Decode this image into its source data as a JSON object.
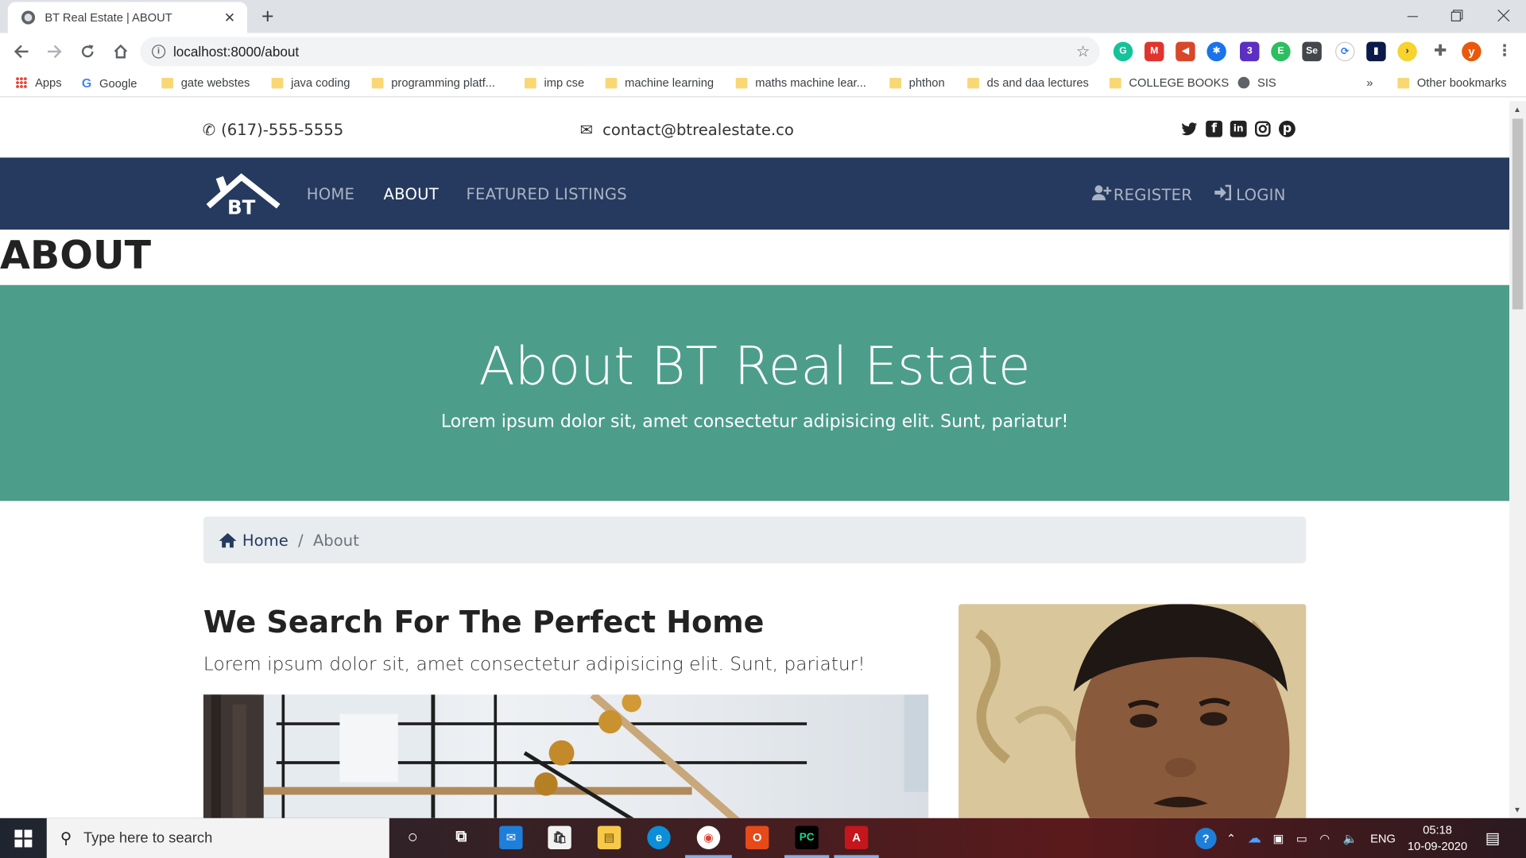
{
  "browser": {
    "tab_title": "BT Real Estate | ABOUT",
    "tab_close": "✕",
    "new_tab": "+",
    "url": "localhost:8000/about",
    "bookmarks": [
      {
        "label": "Apps",
        "icon": "apps-grid-icon"
      },
      {
        "label": "Google",
        "icon": "google-icon"
      },
      {
        "label": "gate webstes",
        "icon": "folder-icon"
      },
      {
        "label": "java coding",
        "icon": "folder-icon"
      },
      {
        "label": "programming platf...",
        "icon": "folder-icon"
      },
      {
        "label": "imp cse",
        "icon": "folder-icon"
      },
      {
        "label": "machine learning",
        "icon": "folder-icon"
      },
      {
        "label": "maths machine lear...",
        "icon": "folder-icon"
      },
      {
        "label": "phthon",
        "icon": "folder-icon"
      },
      {
        "label": "ds and daa lectures",
        "icon": "folder-icon"
      },
      {
        "label": "COLLEGE BOOKS",
        "icon": "folder-icon"
      },
      {
        "label": "SIS",
        "icon": "globe-icon"
      }
    ],
    "bookmarks_overflow": "»",
    "other_bookmarks": "Other bookmarks",
    "profile_initial": "y"
  },
  "site": {
    "phone": "(617)-555-5555",
    "email": "contact@btrealestate.co",
    "logo_text": "BT",
    "nav": {
      "home": "HOME",
      "about": "ABOUT",
      "featured": "FEATURED LISTINGS",
      "register": "REGISTER",
      "login": "LOGIN"
    },
    "page_heading": "ABOUT",
    "hero_title": "About BT Real Estate",
    "hero_subtitle": "Lorem ipsum dolor sit, amet consectetur adipisicing elit. Sunt, pariatur!",
    "breadcrumb": {
      "home": "Home",
      "separator": "/",
      "current": "About"
    },
    "section_title": "We Search For The Perfect Home",
    "section_lead": "Lorem ipsum dolor sit, amet consectetur adipisicing elit. Sunt, pariatur!"
  },
  "taskbar": {
    "search_placeholder": "Type here to search",
    "language": "ENG",
    "time": "05:18",
    "date": "10-09-2020",
    "extension_badge": "3"
  },
  "colors": {
    "navbar": "#253a5e",
    "hero": "#4c9e8a"
  }
}
